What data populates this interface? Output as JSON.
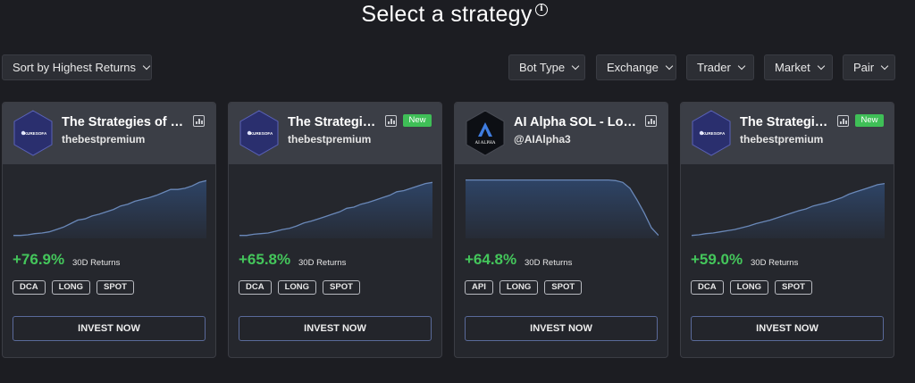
{
  "page": {
    "title": "Select a strategy",
    "info_glyph": "i"
  },
  "filters": {
    "sort_label": "Sort by Highest Returns",
    "bot_type": "Bot Type",
    "exchange": "Exchange",
    "trader": "Trader",
    "market": "Market",
    "pair": "Pair"
  },
  "colors": {
    "positive": "#44c65b",
    "badge_new": "#3fbf57",
    "spark_line": "#6a88b8",
    "spark_fill": "#2e4466"
  },
  "cards": [
    {
      "title": "The Strategies of Kuresofa",
      "user": "thebestpremium",
      "avatar_text": "KURESOFA",
      "avatar_type": "kuresofa",
      "new": false,
      "returns": "+76.9%",
      "returns_label": "30D Returns",
      "tags": [
        "DCA",
        "LONG",
        "SPOT"
      ],
      "cta": "INVEST NOW",
      "trend": [
        0.02,
        0.02,
        0.03,
        0.05,
        0.06,
        0.08,
        0.12,
        0.16,
        0.22,
        0.28,
        0.3,
        0.35,
        0.38,
        0.42,
        0.46,
        0.52,
        0.55,
        0.6,
        0.63,
        0.66,
        0.7,
        0.75,
        0.8,
        0.8,
        0.82,
        0.86,
        0.92,
        0.95
      ]
    },
    {
      "title": "The Strategies of Kuresofa",
      "user": "thebestpremium",
      "avatar_text": "KURESOFA",
      "avatar_type": "kuresofa",
      "new": true,
      "new_label": "New",
      "returns": "+65.8%",
      "returns_label": "30D Returns",
      "tags": [
        "DCA",
        "LONG",
        "SPOT"
      ],
      "cta": "INVEST NOW",
      "trend": [
        0.02,
        0.02,
        0.04,
        0.05,
        0.06,
        0.09,
        0.12,
        0.14,
        0.18,
        0.23,
        0.26,
        0.3,
        0.34,
        0.38,
        0.42,
        0.48,
        0.5,
        0.55,
        0.58,
        0.62,
        0.66,
        0.7,
        0.76,
        0.78,
        0.82,
        0.86,
        0.9,
        0.92
      ]
    },
    {
      "title": "AI Alpha SOL - Long Strategy",
      "user": "@AIAlpha3",
      "avatar_text": "AI ALPHA",
      "avatar_type": "aialpha",
      "new": false,
      "returns": "+64.8%",
      "returns_label": "30D Returns",
      "tags": [
        "API",
        "LONG",
        "SPOT"
      ],
      "cta": "INVEST NOW",
      "trend": [
        0.96,
        0.96,
        0.96,
        0.96,
        0.96,
        0.96,
        0.96,
        0.96,
        0.96,
        0.96,
        0.96,
        0.96,
        0.96,
        0.96,
        0.96,
        0.96,
        0.96,
        0.96,
        0.96,
        0.96,
        0.96,
        0.95,
        0.92,
        0.82,
        0.62,
        0.4,
        0.15,
        0.02
      ]
    },
    {
      "title": "The Strategies of Kuresofa",
      "user": "thebestpremium",
      "avatar_text": "KURESOFA",
      "avatar_type": "kuresofa",
      "new": true,
      "new_label": "New",
      "returns": "+59.0%",
      "returns_label": "30D Returns",
      "tags": [
        "DCA",
        "LONG",
        "SPOT"
      ],
      "cta": "INVEST NOW",
      "trend": [
        0.02,
        0.03,
        0.05,
        0.06,
        0.08,
        0.1,
        0.12,
        0.15,
        0.18,
        0.22,
        0.25,
        0.28,
        0.32,
        0.36,
        0.4,
        0.44,
        0.47,
        0.52,
        0.55,
        0.58,
        0.62,
        0.66,
        0.72,
        0.76,
        0.8,
        0.84,
        0.88,
        0.9
      ]
    }
  ]
}
